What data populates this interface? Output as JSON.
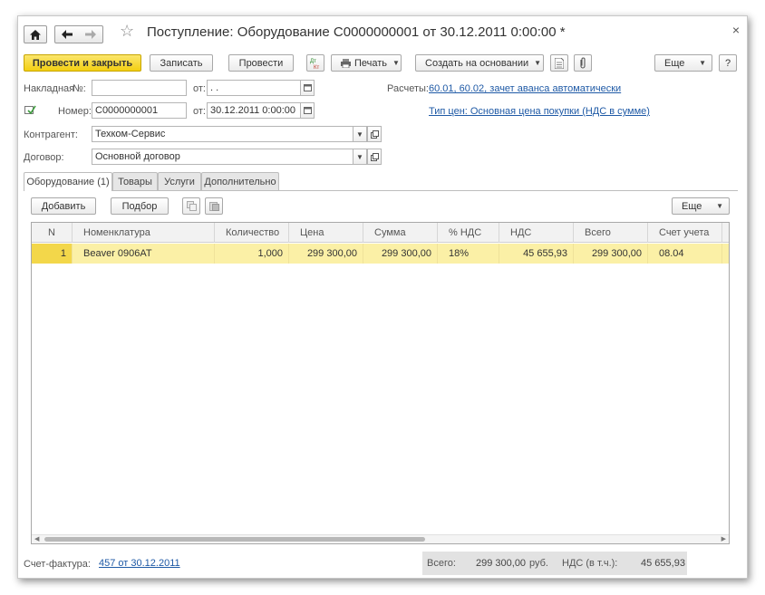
{
  "window": {
    "title": "Поступление: Оборудование С0000000001 от 30.12.2011 0:00:00 *",
    "home_icon": "home-icon",
    "back_icon": "arrow-left-icon",
    "forward_icon": "arrow-right-icon",
    "favorite_icon": "star-icon",
    "close_glyph": "×"
  },
  "toolbar": {
    "post_and_close": "Провести и закрыть",
    "save": "Записать",
    "post": "Провести",
    "dtkt_glyph": "Дт\nКт",
    "print": "Печать",
    "create_based_on": "Создать на основании",
    "more": "Еще",
    "help": "?"
  },
  "form": {
    "invoice_label": "Накладная",
    "invoice_no_label": "№:",
    "invoice_no_value": "",
    "invoice_from_label": "от:",
    "invoice_date_value": " .  .",
    "number_label": "Номер:",
    "number_value": "С0000000001",
    "number_from_label": "от:",
    "date_value": "30.12.2011  0:00:00",
    "counterparty_label": "Контрагент:",
    "counterparty_value": "Техком-Сервис",
    "contract_label": "Договор:",
    "contract_value": "Основной договор",
    "settlements_label": "Расчеты:",
    "settlements_link": "60.01, 60.02, зачет аванса автоматически",
    "price_type_link": "Тип цен: Основная цена покупки (НДС в сумме)"
  },
  "tabs": [
    {
      "label": "Оборудование (1)",
      "active": true
    },
    {
      "label": "Товары",
      "active": false
    },
    {
      "label": "Услуги",
      "active": false
    },
    {
      "label": "Дополнительно",
      "active": false
    }
  ],
  "table_toolbar": {
    "add": "Добавить",
    "pick": "Подбор",
    "more": "Еще"
  },
  "table": {
    "columns": [
      "N",
      "Номенклатура",
      "Количество",
      "Цена",
      "Сумма",
      "% НДС",
      "НДС",
      "Всего",
      "Счет учета"
    ],
    "rows": [
      [
        "1",
        "Beaver 0906AT",
        "1,000",
        "299 300,00",
        "299 300,00",
        "18%",
        "45 655,93",
        "299 300,00",
        "08.04"
      ]
    ]
  },
  "footer": {
    "invoice_label": "Счет-фактура:",
    "invoice_link": "457 от 30.12.2011",
    "total_label": "Всего:",
    "total_value": "299 300,00",
    "currency": "руб.",
    "vat_label": "НДС (в т.ч.):",
    "vat_value": "45 655,93"
  },
  "colors": {
    "primary_button": "#f3cf12",
    "selected_row": "#fbf0a6",
    "link": "#1f5aa6"
  }
}
